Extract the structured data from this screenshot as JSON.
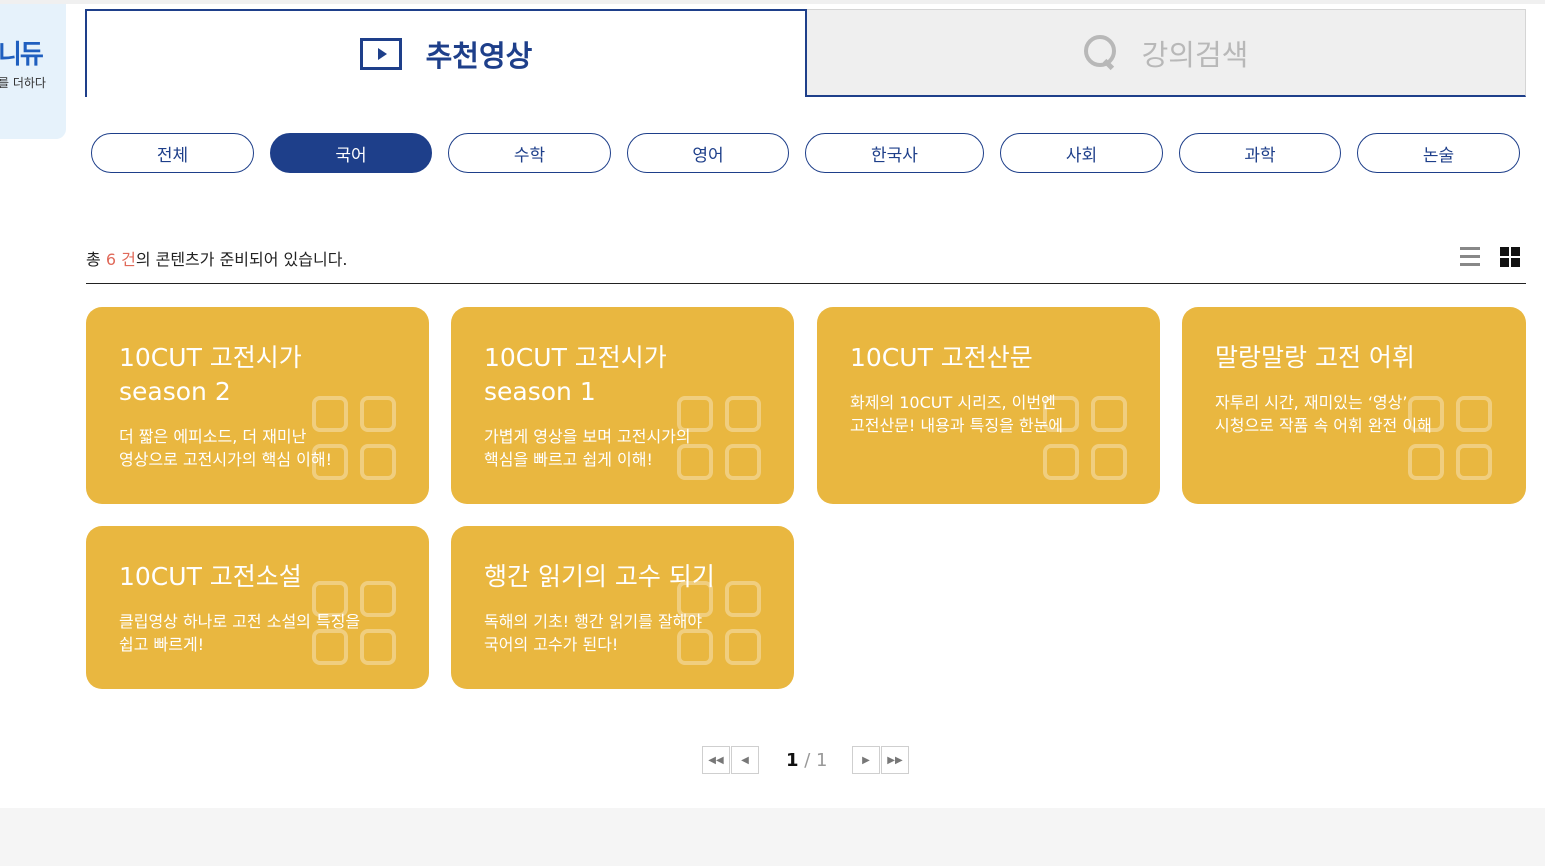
{
  "brand": {
    "logo_text": "니듀",
    "logo_sub": "를 더하다"
  },
  "tabs": {
    "recommend_label": "추천영상",
    "search_label": "강의검색"
  },
  "subjects": [
    "전체",
    "국어",
    "수학",
    "영어",
    "한국사",
    "사회",
    "과학",
    "논술"
  ],
  "active_subject": "국어",
  "summary": {
    "prefix": "총 ",
    "count": "6 건",
    "suffix": "의 콘텐츠가 준비되어 있습니다."
  },
  "cards": [
    {
      "title": "10CUT 고전시가\nseason 2",
      "desc": "더 짧은 에피소드, 더 재미난\n영상으로 고전시가의 핵심 이해!"
    },
    {
      "title": "10CUT 고전시가\nseason 1",
      "desc": "가볍게 영상을 보며 고전시가의\n핵심을 빠르고 쉽게 이해!"
    },
    {
      "title": "10CUT 고전산문",
      "desc": "화제의 10CUT 시리즈, 이번엔\n고전산문! 내용과 특징을 한눈에"
    },
    {
      "title": "말랑말랑 고전 어휘",
      "desc": "자투리 시간, 재미있는 ‘영상’\n시청으로 작품 속 어휘 완전 이해"
    },
    {
      "title": "10CUT 고전소설",
      "desc": "클립영상 하나로 고전 소설의 특징을\n쉽고 빠르게!"
    },
    {
      "title": "행간 읽기의 고수 되기",
      "desc": "독해의 기초! 행간 읽기를 잘해야\n국어의 고수가 된다!"
    }
  ],
  "card_color": "#e9b740",
  "accent_color": "#1e3f8a",
  "pagination": {
    "current": "1",
    "separator": " / ",
    "total": "1",
    "first_icon": "first-page-icon",
    "prev_icon": "prev-page-icon",
    "next_icon": "next-page-icon",
    "last_icon": "last-page-icon"
  },
  "icons": {
    "recommend_tab": "play-icon",
    "search_tab": "search-icon",
    "list_view": "list-view-icon",
    "grid_view": "grid-view-icon"
  }
}
